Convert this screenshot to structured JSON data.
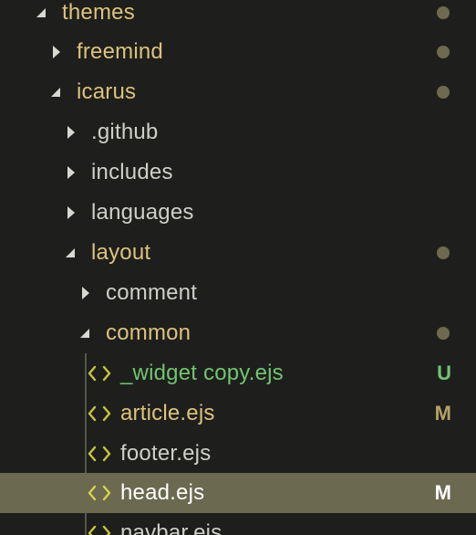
{
  "colors": {
    "background": "#1e1f1c",
    "selection": "#6b6a50",
    "modified_text": "#dcc27e",
    "untracked_text": "#72c372",
    "plain_text": "#cfcfc9",
    "status_dot": "#6e6a4e",
    "icon_color": "#c6c640"
  },
  "tree": {
    "items": [
      {
        "label": "themes",
        "type": "folder",
        "state": "expanded",
        "dot": true
      },
      {
        "label": "freemind",
        "type": "folder",
        "state": "collapsed",
        "dot": true
      },
      {
        "label": "icarus",
        "type": "folder",
        "state": "expanded",
        "dot": true
      },
      {
        "label": ".github",
        "type": "folder",
        "state": "collapsed"
      },
      {
        "label": "includes",
        "type": "folder",
        "state": "collapsed"
      },
      {
        "label": "languages",
        "type": "folder",
        "state": "collapsed"
      },
      {
        "label": "layout",
        "type": "folder",
        "state": "expanded",
        "dot": true
      },
      {
        "label": "comment",
        "type": "folder",
        "state": "collapsed"
      },
      {
        "label": "common",
        "type": "folder",
        "state": "expanded",
        "dot": true
      },
      {
        "label": "_widget copy.ejs",
        "type": "file",
        "icon": "code-file-icon",
        "status": "U"
      },
      {
        "label": "article.ejs",
        "type": "file",
        "icon": "code-file-icon",
        "status": "M"
      },
      {
        "label": "footer.ejs",
        "type": "file",
        "icon": "code-file-icon"
      },
      {
        "label": "head.ejs",
        "type": "file",
        "icon": "code-file-icon",
        "status": "M",
        "selected": true
      },
      {
        "label": "navbar.ejs",
        "type": "file",
        "icon": "code-file-icon"
      }
    ]
  }
}
